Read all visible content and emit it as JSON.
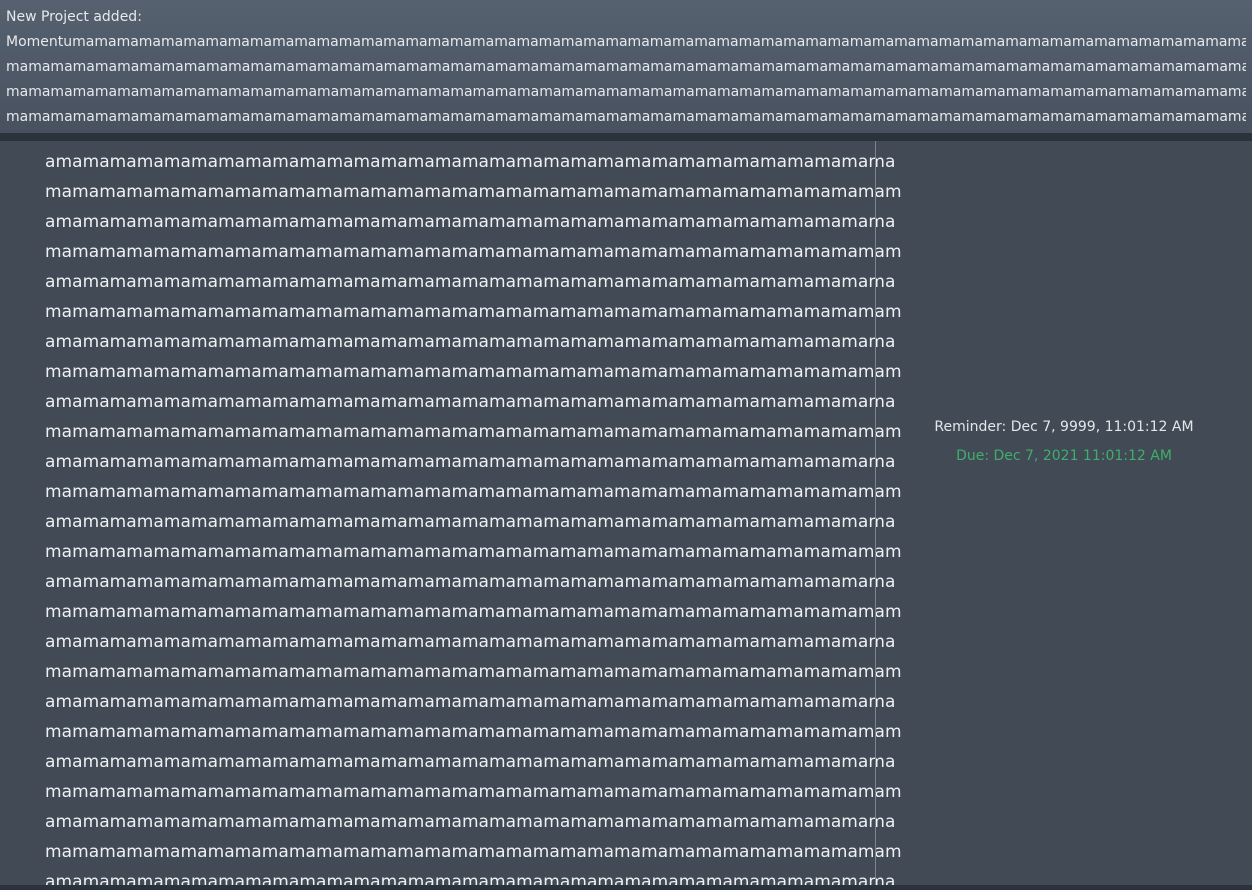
{
  "notification": {
    "heading": "New Project added:",
    "lines": [
      "Momentumamamamamamamamamamamamamamamamamamamamamamamamamamamamamamamamamamamamamamamamamamamamamamamamamamamamamamamamamamamama",
      "mamamamamamamamamamamamamamamamamamamamamamamamamamamamamamamamamamamamamamamamamamamamamamamamamamamamamamamamamamamamamama",
      "mamamamamamamamamamamamamamamamamamamamamamamamamamamamamamamamamamamamamamamamamamamamamamamamamamamamamamamamamamamamamama",
      "mamamamamamamamamamamamamamamamamamamamamamamamamamamamamamamamamamamamamamamamamamamamamamamamamamamamamamamamamamamamamama"
    ]
  },
  "project": {
    "description_rows": [
      "amamamamamamamamamamamamamamamamamamamamamamamamamamamamamamama",
      "mamamamamamamamamamamamamamamamamamamamamamamamamamamamamamamam",
      "amamamamamamamamamamamamamamamamamamamamamamamamamamamamamamama",
      "mamamamamamamamamamamamamamamamamamamamamamamamamamamamamamamam",
      "amamamamamamamamamamamamamamamamamamamamamamamamamamamamamamama",
      "mamamamamamamamamamamamamamamamamamamamamamamamamamamamamamamam",
      "amamamamamamamamamamamamamamamamamamamamamamamamamamamamamamama",
      "mamamamamamamamamamamamamamamamamamamamamamamamamamamamamamamam",
      "amamamamamamamamamamamamamamamamamamamamamamamamamamamamamamama",
      "mamamamamamamamamamamamamamamamamamamamamamamamamamamamamamamam",
      "amamamamamamamamamamamamamamamamamamamamamamamamamamamamamamama",
      "mamamamamamamamamamamamamamamamamamamamamamamamamamamamamamamam",
      "amamamamamamamamamamamamamamamamamamamamamamamamamamamamamamama",
      "mamamamamamamamamamamamamamamamamamamamamamamamamamamamamamamam",
      "amamamamamamamamamamamamamamamamamamamamamamamamamamamamamamama",
      "mamamamamamamamamamamamamamamamamamamamamamamamamamamamamamamam",
      "amamamamamamamamamamamamamamamamamamamamamamamamamamamamamamama",
      "mamamamamamamamamamamamamamamamamamamamamamamamamamamamamamamam",
      "amamamamamamamamamamamamamamamamamamamamamamamamamamamamamamama",
      "mamamamamamamamamamamamamamamamamamamamamamamamamamamamamamamam",
      "amamamamamamamamamamamamamamamamamamamamamamamamamamamamamamama",
      "mamamamamamamamamamamamamamamamamamamamamamamamamamamamamamamam",
      "amamamamamamamamamamamamamamamamamamamamamamamamamamamamamamama",
      "mamamamamamamamamamamamamamamamamamamamamamamamamamamamamamamam",
      "amamamamamamamamamamamamamamamamamamamamamamamamamamamamamamama"
    ],
    "reminder": "Reminder: Dec 7, 9999, 11:01:12 AM",
    "due": "Due: Dec 7, 2021 11:01:12 AM"
  },
  "colors": {
    "banner_bg": "#566170",
    "card_bg": "#414a55",
    "due_text": "#3fae6b",
    "page_bg": "#2b323b"
  }
}
